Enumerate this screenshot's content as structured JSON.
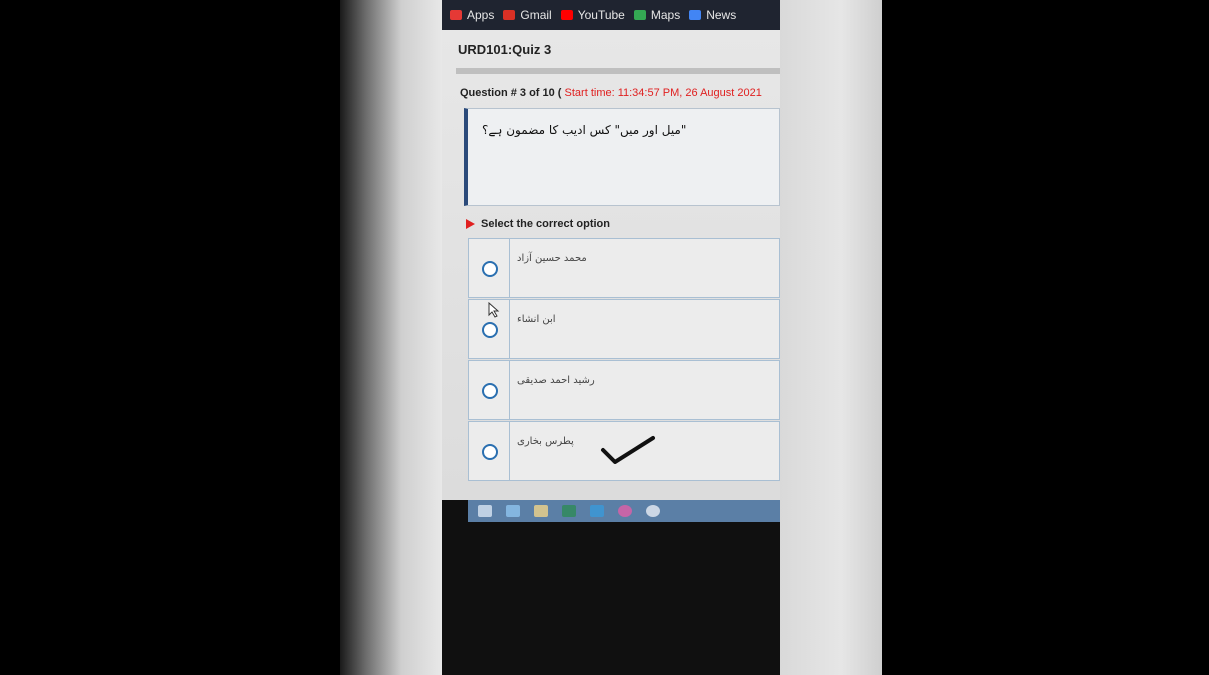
{
  "bookmarks": [
    {
      "label": "Apps",
      "icon": "apps-grid-icon",
      "color": "#e53935"
    },
    {
      "label": "Gmail",
      "icon": "gmail-icon",
      "color": "#d93025"
    },
    {
      "label": "YouTube",
      "icon": "youtube-icon",
      "color": "#ff0000"
    },
    {
      "label": "Maps",
      "icon": "maps-icon",
      "color": "#34a853"
    },
    {
      "label": "News",
      "icon": "news-icon",
      "color": "#4285f4"
    }
  ],
  "quiz": {
    "title": "URD101:Quiz 3",
    "question_prefix": "Question # 3 of 10 (",
    "start_time": "Start time: 11:34:57 PM, 26 August 2021",
    "question_text": "\"میل اور میں\" کس ادیب کا مضمون ہے؟",
    "select_label": "Select the correct option",
    "options": [
      {
        "text": "محمد حسین آزاد"
      },
      {
        "text": "ابن انشاء"
      },
      {
        "text": "رشید احمد صدیقی"
      },
      {
        "text": "پطرس بخاری",
        "marked": true
      }
    ]
  },
  "colors": {
    "accent_red": "#e02020",
    "radio_blue": "#2a6fb0",
    "border_blue": "#a9bfd3",
    "question_border": "#2b4a7a"
  }
}
